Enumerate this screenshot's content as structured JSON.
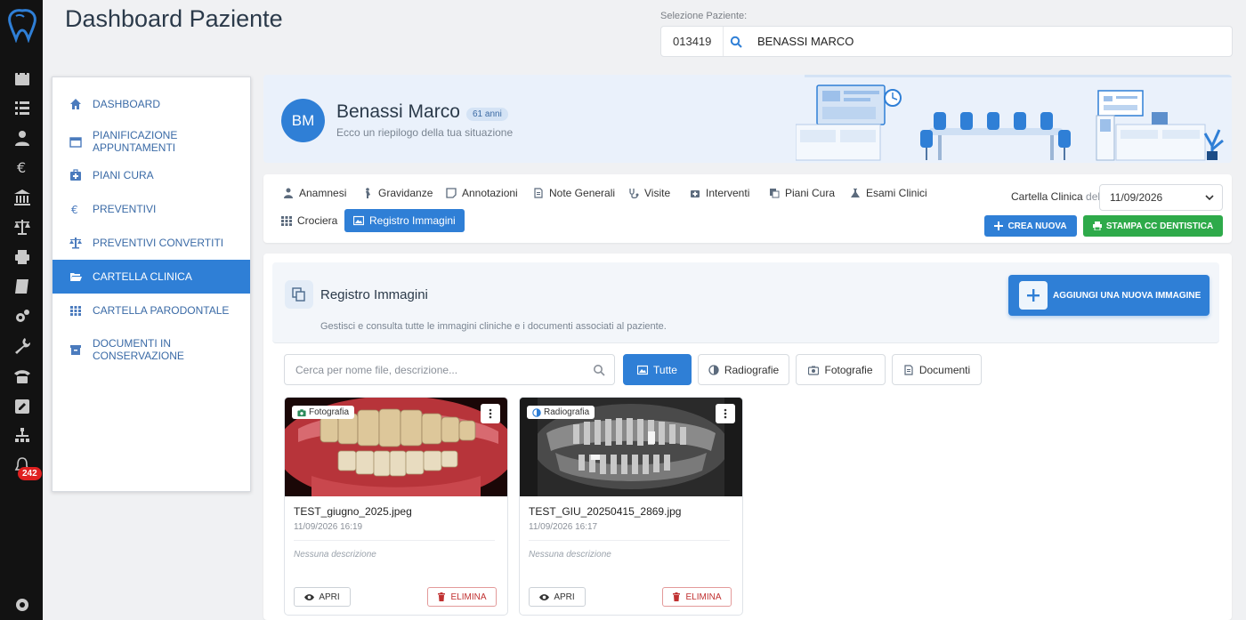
{
  "header": {
    "title": "Dashboard Paziente",
    "selector_label": "Selezione Paziente:",
    "patient_code": "013419",
    "patient_name": "BENASSI MARCO"
  },
  "rail": {
    "icons": [
      "tooth-logo-icon",
      "calendar-icon",
      "list-icon",
      "users-icon",
      "euro-icon",
      "bank-icon",
      "balance-icon",
      "print-icon",
      "book-icon",
      "settings-gears-icon",
      "wrench-icon",
      "phone-icon",
      "edit-icon",
      "sitemap-icon",
      "bell-icon",
      "gear-icon"
    ],
    "notifications_count": "242"
  },
  "sidebar": {
    "items": [
      {
        "label": "DASHBOARD",
        "icon": "home-icon"
      },
      {
        "label": "PIANIFICAZIONE APPUNTAMENTI",
        "icon": "calendar-icon"
      },
      {
        "label": "PIANI CURA",
        "icon": "medkit-icon"
      },
      {
        "label": "PREVENTIVI",
        "icon": "euro-icon"
      },
      {
        "label": "PREVENTIVI CONVERTITI",
        "icon": "balance-icon"
      },
      {
        "label": "CARTELLA CLINICA",
        "icon": "folder-open-icon",
        "active": true
      },
      {
        "label": "CARTELLA PARODONTALE",
        "icon": "grid-icon"
      },
      {
        "label": "DOCUMENTI IN CONSERVAZIONE",
        "icon": "archive-icon"
      }
    ]
  },
  "patient": {
    "initials": "BM",
    "name": "Benassi Marco",
    "age": "61 anni",
    "subtitle": "Ecco un riepilogo della tua situazione"
  },
  "tabs": [
    {
      "label": "Anamnesi",
      "icon": "user-md-icon"
    },
    {
      "label": "Gravidanze",
      "icon": "pregnant-icon"
    },
    {
      "label": "Annotazioni",
      "icon": "sticky-note-icon"
    },
    {
      "label": "Note Generali",
      "icon": "file-text-icon"
    },
    {
      "label": "Visite",
      "icon": "stethoscope-icon"
    },
    {
      "label": "Interventi",
      "icon": "medkit-icon"
    },
    {
      "label": "Piani Cura",
      "icon": "copy-icon"
    },
    {
      "label": "Esami Clinici",
      "icon": "flask-icon"
    },
    {
      "label": "Crociera",
      "icon": "grid-icon"
    },
    {
      "label": "Registro Immagini",
      "icon": "image-icon",
      "active": true
    }
  ],
  "cartella": {
    "label": "Cartella Clinica",
    "del": "del",
    "date": "11/09/2026",
    "crea_label": "CREA NUOVA",
    "stampa_label": "STAMPA CC DENTISTICA"
  },
  "registro": {
    "title": "Registro Immagini",
    "subtitle": "Gestisci e consulta tutte le immagini cliniche e i documenti associati al paziente.",
    "add_label": "AGGIUNGI UNA NUOVA IMMAGINE",
    "search_placeholder": "Cerca per nome file, descrizione...",
    "filters": [
      {
        "label": "Tutte",
        "icon": "image-icon",
        "active": true
      },
      {
        "label": "Radiografie",
        "icon": "half-circle-icon"
      },
      {
        "label": "Fotografie",
        "icon": "camera-icon"
      },
      {
        "label": "Documenti",
        "icon": "file-icon"
      }
    ],
    "items": [
      {
        "tag": "Fotografia",
        "tag_icon": "camera-icon",
        "filename": "TEST_giugno_2025.jpeg",
        "datetime": "11/09/2026 16:19",
        "description": "Nessuna descrizione",
        "open_label": "APRI",
        "delete_label": "ELIMINA"
      },
      {
        "tag": "Radiografia",
        "tag_icon": "half-circle-icon",
        "filename": "TEST_GIU_20250415_2869.jpg",
        "datetime": "11/09/2026 16:17",
        "description": "Nessuna descrizione",
        "open_label": "APRI",
        "delete_label": "ELIMINA"
      }
    ]
  },
  "colors": {
    "primary": "#2f7fd6",
    "success": "#2eaa4a",
    "danger": "#c03030",
    "rail": "#121212"
  }
}
